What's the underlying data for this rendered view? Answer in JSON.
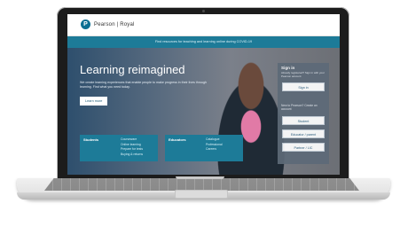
{
  "brand": {
    "logo_letter": "P",
    "logo_text": "Pearson | Royal"
  },
  "banner": {
    "text": "Find resources for teaching and learning online during COVID-19"
  },
  "hero": {
    "title": "Learning reimagined",
    "subtitle": "We create learning experiences that enable people to make progress in their lives through learning. Find what you need today.",
    "button_label": "Learn more"
  },
  "signin": {
    "title": "Sign in",
    "description": "Already registered? Sign in with your Pearson account",
    "signin_button": "Sign in",
    "register_text": "New to Pearson? Create an account",
    "student_button": "Student",
    "educator_button": "Educator / parent",
    "partner_button": "Partner / LIC"
  },
  "cards": [
    {
      "title": "Students",
      "links": [
        "Courseware",
        "Online learning",
        "Prepare for tests",
        "Buying & returns"
      ]
    },
    {
      "title": "Educators",
      "links": [
        "Catalogue",
        "Professional",
        "Careers"
      ]
    }
  ],
  "colors": {
    "accent": "#1d7b98",
    "frame": "#1c1c1c"
  }
}
